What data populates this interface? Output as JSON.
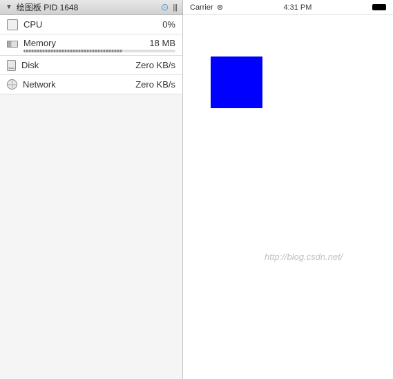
{
  "statusBar": {
    "title": "绘图板 PID 1648",
    "recordIcon": "⊙",
    "audioIcon": "|||",
    "carrier": "Carrier",
    "wifi": "▾",
    "time": "4:31 PM",
    "battery": "■"
  },
  "processPanel": {
    "rows": [
      {
        "id": "cpu",
        "icon": "cpu-icon",
        "label": "CPU",
        "value": "0%"
      },
      {
        "id": "memory",
        "icon": "memory-icon",
        "label": "Memory",
        "value": "18 MB"
      },
      {
        "id": "disk",
        "icon": "disk-icon",
        "label": "Disk",
        "value": "Zero KB/s"
      },
      {
        "id": "network",
        "icon": "network-icon",
        "label": "Network",
        "value": "Zero KB/s"
      }
    ]
  },
  "ios": {
    "carrier": "Carrier",
    "wifi": "▾",
    "time": "4:31 PM"
  },
  "watermark": "http://blog.csdn.net/"
}
